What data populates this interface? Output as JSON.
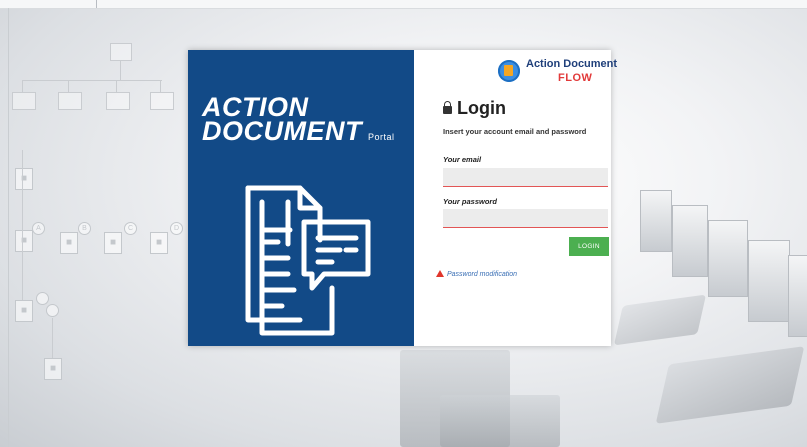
{
  "brand": {
    "line1": "ACTION",
    "line2": "DOCUMENT",
    "portal": "Portal"
  },
  "logo": {
    "line1": "Action Document",
    "line2": "FLOW",
    "icon": "document-flow-logo-icon"
  },
  "login": {
    "title": "Login",
    "subtitle": "Insert your account email and password",
    "email_label": "Your email",
    "email_value": "",
    "password_label": "Your password",
    "password_value": "",
    "button_label": "LOGIN",
    "password_link": "Password modification"
  },
  "colors": {
    "panel_blue": "#124a87",
    "login_green": "#4caf50",
    "flow_red": "#e23a3a",
    "field_underline": "#e25555"
  },
  "icons": {
    "lock": "lock-icon",
    "warning": "warning-icon",
    "illustration": "documents-chat-illustration"
  }
}
